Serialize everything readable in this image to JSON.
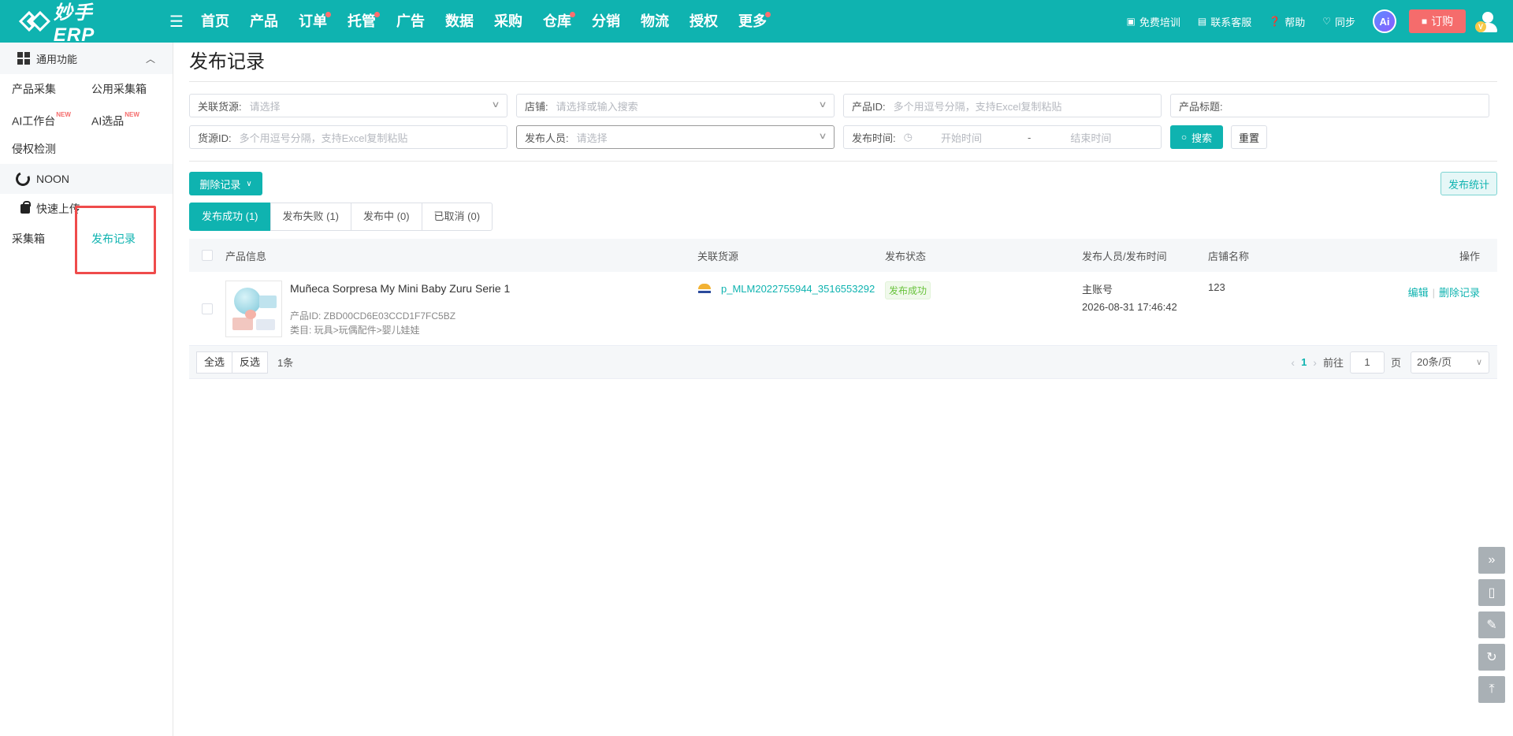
{
  "brand": {
    "name": "妙手ERP"
  },
  "nav": {
    "items": [
      {
        "label": "首页",
        "dot": false
      },
      {
        "label": "产品",
        "dot": false
      },
      {
        "label": "订单",
        "dot": true
      },
      {
        "label": "托管",
        "dot": true
      },
      {
        "label": "广告",
        "dot": false
      },
      {
        "label": "数据",
        "dot": false
      },
      {
        "label": "采购",
        "dot": false
      },
      {
        "label": "仓库",
        "dot": true
      },
      {
        "label": "分销",
        "dot": false
      },
      {
        "label": "物流",
        "dot": false
      },
      {
        "label": "授权",
        "dot": false
      },
      {
        "label": "更多",
        "dot": true
      }
    ]
  },
  "topbar": {
    "training": "免费培训",
    "support": "联系客服",
    "help": "帮助",
    "sync": "同步",
    "ai": "Ai",
    "order": "订购",
    "vip": "V"
  },
  "sidebar": {
    "group_title": "通用功能",
    "links": [
      {
        "label": "产品采集",
        "badge": ""
      },
      {
        "label": "公用采集箱",
        "badge": ""
      },
      {
        "label": "AI工作台",
        "badge": "NEW"
      },
      {
        "label": "AI选品",
        "badge": "NEW"
      },
      {
        "label": "侵权检测",
        "badge": ""
      }
    ],
    "section": "NOON",
    "sub": "快速上传",
    "bottom_links": [
      {
        "label": "采集箱"
      },
      {
        "label": "发布记录"
      }
    ]
  },
  "page": {
    "title": "发布记录"
  },
  "filters": {
    "source": {
      "label": "关联货源:",
      "placeholder": "请选择"
    },
    "shop": {
      "label": "店铺:",
      "placeholder": "请选择或输入搜索"
    },
    "product_id": {
      "label": "产品ID:",
      "placeholder": "多个用逗号分隔，支持Excel复制粘贴"
    },
    "product_title": {
      "label": "产品标题:",
      "placeholder": ""
    },
    "source_id": {
      "label": "货源ID:",
      "placeholder": "多个用逗号分隔，支持Excel复制粘贴"
    },
    "publisher": {
      "label": "发布人员:",
      "placeholder": "请选择"
    },
    "publish_time": {
      "label": "发布时间:",
      "start": "开始时间",
      "sep": "-",
      "end": "结束时间"
    },
    "search": "搜索",
    "reset": "重置"
  },
  "toolbar": {
    "delete": "删除记录",
    "stats": "发布统计"
  },
  "tabs": [
    {
      "label": "发布成功 (1)",
      "active": true
    },
    {
      "label": "发布失败 (1)",
      "active": false
    },
    {
      "label": "发布中 (0)",
      "active": false
    },
    {
      "label": "已取消 (0)",
      "active": false
    }
  ],
  "table": {
    "columns": [
      "产品信息",
      "关联货源",
      "发布状态",
      "发布人员/发布时间",
      "店铺名称",
      "操作"
    ],
    "rows": [
      {
        "name": "Muñeca Sorpresa My Mini Baby Zuru Serie 1",
        "product_id": "产品ID: ZBD00CD6E03CCD1F7FC5BZ",
        "category": "类目: 玩具>玩偶配件>婴儿娃娃",
        "source": "p_MLM2022755944_3516553292",
        "status": "发布成功",
        "user": "主账号",
        "time": "2026-08-31 17:46:42",
        "shop": "123",
        "edit": "编辑",
        "delete": "删除记录"
      }
    ]
  },
  "footer": {
    "select_all": "全选",
    "invert": "反选",
    "count": "1条",
    "page": "1",
    "goto_label": "前往",
    "goto_value": "1",
    "page_unit": "页",
    "page_size": "20条/页"
  },
  "colors": {
    "accent": "#0fb3b0",
    "danger": "#f56c6c",
    "success": "#67c23a"
  }
}
